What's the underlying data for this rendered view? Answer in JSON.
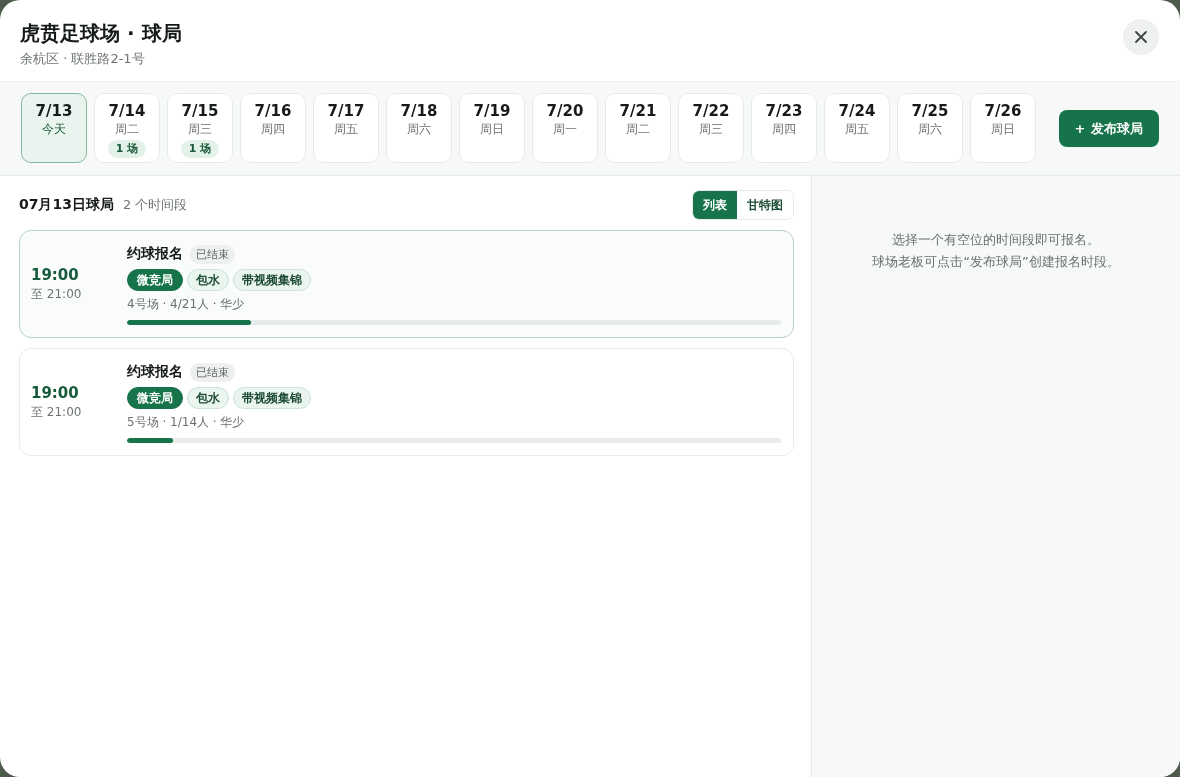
{
  "header": {
    "title": "虎贲足球场 · 球局",
    "subtitle": "余杭区 · 联胜路2-1号"
  },
  "dates": [
    {
      "date": "7/13",
      "weekday": "今天",
      "selected": true
    },
    {
      "date": "7/14",
      "weekday": "周二",
      "count": "1 场",
      "selected": false
    },
    {
      "date": "7/15",
      "weekday": "周三",
      "count": "1 场",
      "selected": false
    },
    {
      "date": "7/16",
      "weekday": "周四",
      "selected": false
    },
    {
      "date": "7/17",
      "weekday": "周五",
      "selected": false
    },
    {
      "date": "7/18",
      "weekday": "周六",
      "selected": false
    },
    {
      "date": "7/19",
      "weekday": "周日",
      "selected": false
    },
    {
      "date": "7/20",
      "weekday": "周一",
      "selected": false
    },
    {
      "date": "7/21",
      "weekday": "周二",
      "selected": false
    },
    {
      "date": "7/22",
      "weekday": "周三",
      "selected": false
    },
    {
      "date": "7/23",
      "weekday": "周四",
      "selected": false
    },
    {
      "date": "7/24",
      "weekday": "周五",
      "selected": false
    },
    {
      "date": "7/25",
      "weekday": "周六",
      "selected": false
    },
    {
      "date": "7/26",
      "weekday": "周日",
      "selected": false
    }
  ],
  "publish_button": {
    "icon": "+",
    "label": "发布球局"
  },
  "list": {
    "title": "07月13日球局",
    "count": "2 个时间段",
    "view_tabs": [
      {
        "label": "列表",
        "selected": true
      },
      {
        "label": "甘特图",
        "selected": false
      }
    ],
    "slots": [
      {
        "start": "19:00",
        "end": "至 21:00",
        "title": "约球报名",
        "status": "已结束",
        "tags": [
          {
            "label": "微竞局",
            "kind": "primary"
          },
          {
            "label": "包水",
            "kind": "plain"
          },
          {
            "label": "带视频集锦",
            "kind": "plain"
          }
        ],
        "info": "4号场 · 4/21人 · 华少",
        "level": 0.19,
        "selected": true
      },
      {
        "start": "19:00",
        "end": "至 21:00",
        "title": "约球报名",
        "status": "已结束",
        "tags": [
          {
            "label": "微竞局",
            "kind": "primary"
          },
          {
            "label": "包水",
            "kind": "plain"
          },
          {
            "label": "带视频集锦",
            "kind": "plain"
          }
        ],
        "info": "5号场 · 1/14人 · 华少",
        "level": 0.07,
        "selected": false
      }
    ]
  },
  "hint": {
    "lines": [
      "选择一个有空位的时间段即可报名。",
      "球场老板可点击“发布球局”创建报名时段。"
    ]
  }
}
